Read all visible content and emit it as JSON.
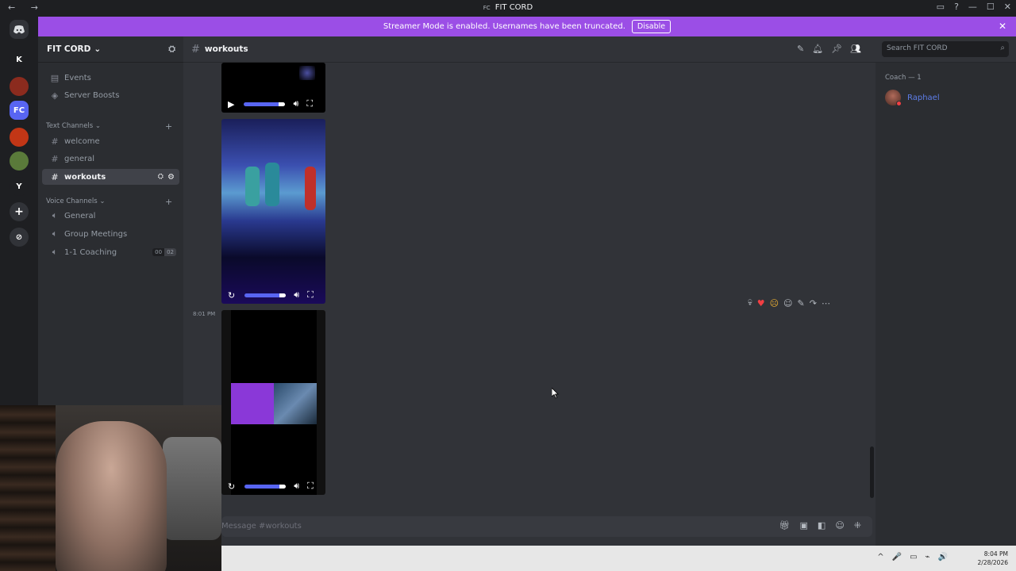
{
  "window": {
    "title": "FIT CORD",
    "title_badge": "FC",
    "back": "←",
    "forward": "→",
    "controls": [
      "▭",
      "?",
      "—",
      "☐",
      "✕"
    ]
  },
  "rail": {
    "home_icon": "discord-icon",
    "servers": [
      {
        "label": "K",
        "color": "#1e1f22"
      },
      {
        "label": "",
        "color": "#8b2b1e"
      },
      {
        "label": "FC",
        "color": "#5865f2"
      },
      {
        "label": "",
        "color": "#c23616"
      },
      {
        "label": "",
        "color": "#5a7a3a"
      },
      {
        "label": "Y",
        "color": "#1e1f22"
      }
    ],
    "add_label": "+",
    "discover_label": "⊘"
  },
  "banner": {
    "text": "Streamer Mode is enabled. Usernames have been truncated.",
    "disable_label": "Disable",
    "close": "✕"
  },
  "sidebar": {
    "server_name": "FIT CORD",
    "server_chevron": "⌄",
    "invite_icon": "add-member-icon",
    "items": [
      {
        "label": "Events",
        "icon": "📅"
      },
      {
        "label": "Server Boosts",
        "icon": "◈"
      }
    ],
    "text_category": "Text Channels",
    "text_channels": [
      {
        "label": "welcome"
      },
      {
        "label": "general"
      },
      {
        "label": "workouts",
        "active": true
      }
    ],
    "voice_category": "Voice Channels",
    "voice_channels": [
      {
        "label": "General"
      },
      {
        "label": "Group Meetings"
      },
      {
        "label": "1-1 Coaching",
        "badge_left": "00",
        "badge_right": "02"
      }
    ]
  },
  "channel_header": {
    "name": "workouts",
    "search_placeholder": "Search FIT CORD"
  },
  "messages": {
    "timestamp": "8:01 PM",
    "input_placeholder": "Message #workouts"
  },
  "members": {
    "category": "Coach — 1",
    "name": "Raphael"
  },
  "taskbar": {
    "time": "8:04 PM",
    "date": "2/28/2026",
    "tray": [
      "^",
      "🎤",
      "▭",
      "⌁",
      "🔊"
    ]
  }
}
